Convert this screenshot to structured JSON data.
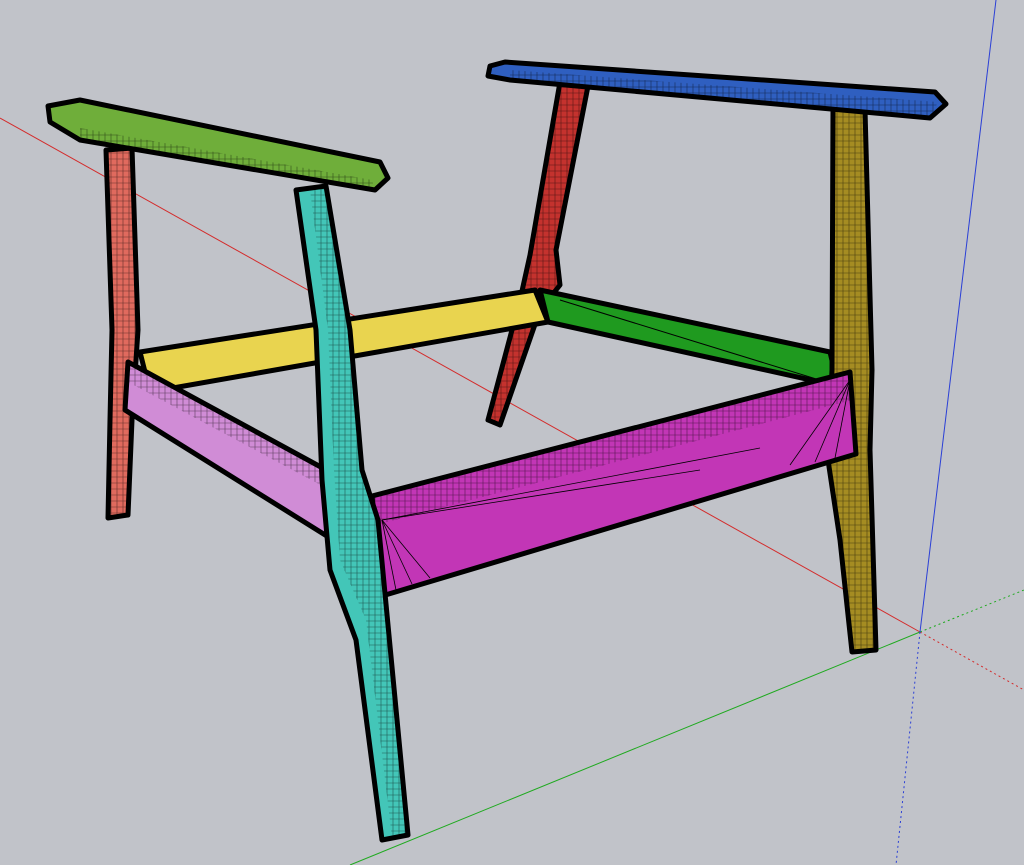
{
  "viewport": {
    "background": "#c1c3c9",
    "axis_colors": {
      "red": "#d42b2b",
      "green": "#1faa1f",
      "blue": "#2a3fd6"
    }
  },
  "model": {
    "edge_color": "#000000",
    "parts": [
      {
        "id": "left-armrest",
        "color": "#6fae3a"
      },
      {
        "id": "right-armrest",
        "color": "#2f5fc0"
      },
      {
        "id": "front-left-leg",
        "color": "#43c6b8"
      },
      {
        "id": "back-left-leg",
        "color": "#e06a5e"
      },
      {
        "id": "back-right-leg",
        "color": "#c4322e"
      },
      {
        "id": "front-right-leg",
        "color": "#a58c22"
      },
      {
        "id": "back-rail",
        "color": "#e9d44f"
      },
      {
        "id": "right-rail",
        "color": "#1f9a1f"
      },
      {
        "id": "left-rail",
        "color": "#d08cd6"
      },
      {
        "id": "front-rail",
        "color": "#c236b6"
      }
    ]
  }
}
